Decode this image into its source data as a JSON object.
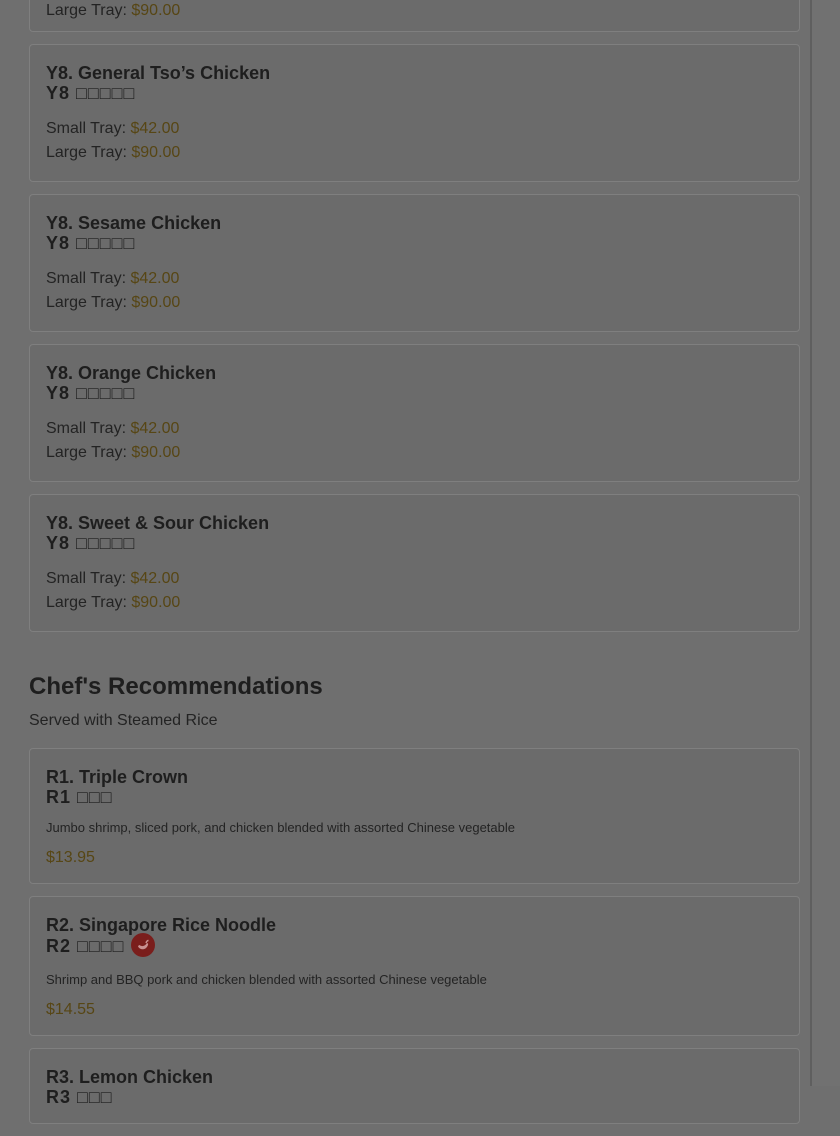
{
  "menu": {
    "top_partial": {
      "label": "Large Tray: ",
      "price": "$90.00"
    },
    "items_y8": [
      {
        "title": "Y8. General Tso’s Chicken",
        "sub": "Y8 □□□□□",
        "small_label": "Small Tray: ",
        "small_price": "$42.00",
        "large_label": "Large Tray: ",
        "large_price": "$90.00"
      },
      {
        "title": "Y8. Sesame Chicken",
        "sub": "Y8 □□□□□",
        "small_label": "Small Tray: ",
        "small_price": "$42.00",
        "large_label": "Large Tray: ",
        "large_price": "$90.00"
      },
      {
        "title": "Y8. Orange Chicken",
        "sub": "Y8 □□□□□",
        "small_label": "Small Tray: ",
        "small_price": "$42.00",
        "large_label": "Large Tray: ",
        "large_price": "$90.00"
      },
      {
        "title": "Y8. Sweet & Sour Chicken",
        "sub": "Y8 □□□□□",
        "small_label": "Small Tray: ",
        "small_price": "$42.00",
        "large_label": "Large Tray: ",
        "large_price": "$90.00"
      }
    ],
    "chef_section": {
      "title": "Chef's Recommendations",
      "subtitle": "Served with Steamed Rice",
      "items": [
        {
          "title": "R1. Triple Crown",
          "sub": "R1 □□□",
          "desc": "Jumbo shrimp, sliced pork, and chicken blended with assorted Chinese vegetable",
          "price": "$13.95",
          "icon": ""
        },
        {
          "title": "R2. Singapore Rice Noodle",
          "sub": "R2 □□□□",
          "desc": "Shrimp and BBQ pork and chicken blended with assorted Chinese vegetable",
          "price": "$14.55",
          "icon": "spicy-icon"
        },
        {
          "title": "R3. Lemon Chicken",
          "sub": "R3 □□□"
        }
      ]
    }
  },
  "colors": {
    "overlay_bg": "#6f6f6f",
    "price": "#574614",
    "spicy": "#7a1e1c"
  }
}
